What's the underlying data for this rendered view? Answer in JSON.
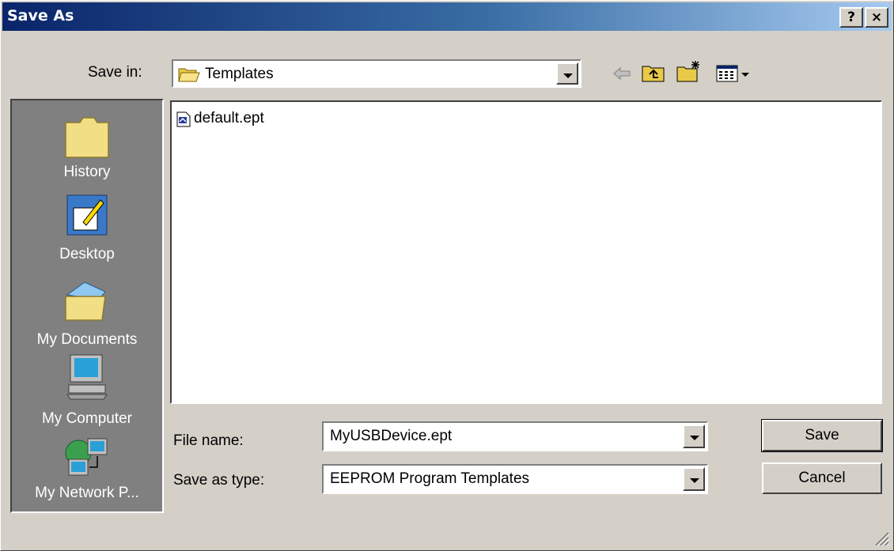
{
  "window": {
    "title": "Save As",
    "help_glyph": "?",
    "close_glyph": "×"
  },
  "toolbar": {
    "save_in_label": "Save in:",
    "save_in_value": "Templates",
    "icons": [
      "back-arrow-icon",
      "up-one-level-icon",
      "create-new-folder-icon",
      "view-menu-icon"
    ]
  },
  "places": [
    {
      "label": "History",
      "icon": "history-folder-icon"
    },
    {
      "label": "Desktop",
      "icon": "desktop-icon"
    },
    {
      "label": "My Documents",
      "icon": "my-documents-icon"
    },
    {
      "label": "My Computer",
      "icon": "my-computer-icon"
    },
    {
      "label": "My Network P...",
      "icon": "my-network-places-icon"
    }
  ],
  "files": [
    {
      "name": "default.ept",
      "icon": "ept-file-icon"
    }
  ],
  "form": {
    "file_name_label": "File name:",
    "file_name_value": "MyUSBDevice.ept",
    "save_type_label": "Save as type:",
    "save_type_value": "EEPROM Program Templates"
  },
  "buttons": {
    "save": "Save",
    "cancel": "Cancel"
  },
  "colors": {
    "title_start": "#0a246a",
    "title_end": "#a6caf0",
    "face": "#d4d0c8",
    "places_bg": "#808080"
  }
}
